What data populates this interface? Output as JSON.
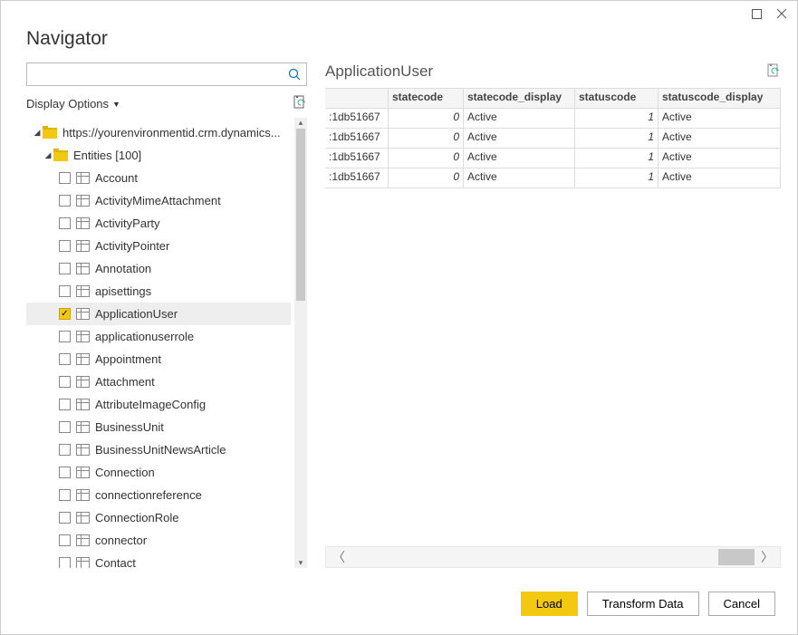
{
  "title": "Navigator",
  "display_options": "Display Options",
  "search": {
    "placeholder": ""
  },
  "tree": {
    "root": "https://yourenvironmentid.crm.dynamics...",
    "group": "Entities [100]",
    "items": [
      {
        "label": "Account",
        "checked": false
      },
      {
        "label": "ActivityMimeAttachment",
        "checked": false
      },
      {
        "label": "ActivityParty",
        "checked": false
      },
      {
        "label": "ActivityPointer",
        "checked": false
      },
      {
        "label": "Annotation",
        "checked": false
      },
      {
        "label": "apisettings",
        "checked": false
      },
      {
        "label": "ApplicationUser",
        "checked": true
      },
      {
        "label": "applicationuserrole",
        "checked": false
      },
      {
        "label": "Appointment",
        "checked": false
      },
      {
        "label": "Attachment",
        "checked": false
      },
      {
        "label": "AttributeImageConfig",
        "checked": false
      },
      {
        "label": "BusinessUnit",
        "checked": false
      },
      {
        "label": "BusinessUnitNewsArticle",
        "checked": false
      },
      {
        "label": "Connection",
        "checked": false
      },
      {
        "label": "connectionreference",
        "checked": false
      },
      {
        "label": "ConnectionRole",
        "checked": false
      },
      {
        "label": "connector",
        "checked": false
      },
      {
        "label": "Contact",
        "checked": false
      }
    ]
  },
  "preview": {
    "title": "ApplicationUser",
    "columns": [
      "",
      "statecode",
      "statecode_display",
      "statuscode",
      "statuscode_display"
    ],
    "rows": [
      {
        "key": ":1db51667",
        "statecode": "0",
        "statecode_display": "Active",
        "statuscode": "1",
        "statuscode_display": "Active"
      },
      {
        "key": ":1db51667",
        "statecode": "0",
        "statecode_display": "Active",
        "statuscode": "1",
        "statuscode_display": "Active"
      },
      {
        "key": ":1db51667",
        "statecode": "0",
        "statecode_display": "Active",
        "statuscode": "1",
        "statuscode_display": "Active"
      },
      {
        "key": ":1db51667",
        "statecode": "0",
        "statecode_display": "Active",
        "statuscode": "1",
        "statuscode_display": "Active"
      }
    ]
  },
  "buttons": {
    "load": "Load",
    "transform": "Transform Data",
    "cancel": "Cancel"
  }
}
